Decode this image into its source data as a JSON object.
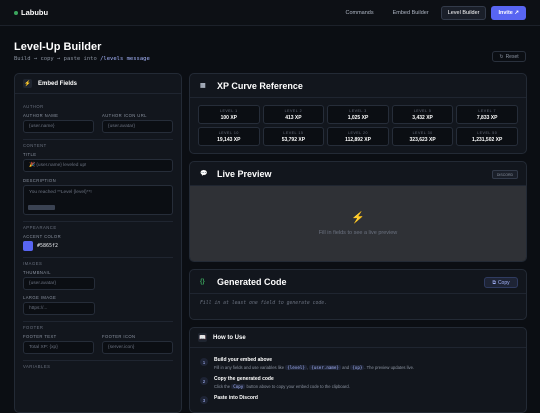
{
  "nav": {
    "logo": "Labubu",
    "links": [
      "Commands",
      "Embed Builder",
      "Level Builder",
      "Invite ↗"
    ]
  },
  "header": {
    "title": "Level-Up Builder",
    "subtitle_prefix": "Build → copy → paste into ",
    "subtitle_cmd": "/levels message",
    "reset": "Reset"
  },
  "embed": {
    "title": "Embed Fields",
    "sections": {
      "author": "AUTHOR",
      "content": "CONTENT",
      "appearance": "APPEARANCE",
      "images": "IMAGES",
      "footer": "FOOTER",
      "variables": "VARIABLES"
    },
    "author_name_label": "AUTHOR NAME",
    "author_name_placeholder": "{user.name}",
    "author_icon_label": "AUTHOR ICON URL",
    "author_icon_placeholder": "{user.avatar}",
    "title_label": "TITLE",
    "title_placeholder": "🎉 {user.name} leveled up!",
    "desc_label": "DESCRIPTION",
    "desc_placeholder": "You reached **Level {level}**!",
    "accent_label": "ACCENT COLOR",
    "accent_value": "#5865f2",
    "thumb_label": "THUMBNAIL",
    "thumb_placeholder": "{user.avatar}",
    "large_label": "LARGE IMAGE",
    "large_placeholder": "https://...",
    "footer_text_label": "FOOTER TEXT",
    "footer_text_placeholder": "Total XP: {xp}",
    "footer_icon_label": "FOOTER ICON",
    "footer_icon_placeholder": "{server.icon}"
  },
  "xp": {
    "title": "XP Curve Reference",
    "levels": [
      {
        "label": "LEVEL 1",
        "value": "100 XP"
      },
      {
        "label": "LEVEL 2",
        "value": "413 XP"
      },
      {
        "label": "LEVEL 3",
        "value": "1,025 XP"
      },
      {
        "label": "LEVEL 5",
        "value": "3,432 XP"
      },
      {
        "label": "LEVEL 7",
        "value": "7,833 XP"
      },
      {
        "label": "LEVEL 10",
        "value": "19,143 XP"
      },
      {
        "label": "LEVEL 15",
        "value": "53,792 XP"
      },
      {
        "label": "LEVEL 20",
        "value": "112,892 XP"
      },
      {
        "label": "LEVEL 30",
        "value": "323,623 XP"
      },
      {
        "label": "LEVEL 50",
        "value": "1,231,502 XP"
      }
    ]
  },
  "preview": {
    "title": "Live Preview",
    "badge": "DISCORD",
    "empty": "Fill in fields to see a live preview"
  },
  "code": {
    "title": "Generated Code",
    "copy": "Copy",
    "empty": "Fill in at least one field to generate code."
  },
  "how": {
    "title": "How to Use",
    "steps": [
      {
        "title": "Build your embed above",
        "desc_a": "Fill in any fields and use variables like ",
        "v1": "{level}",
        "v2": "{user.name}",
        "desc_b": " and ",
        "v3": "{xp}",
        "desc_c": ". The preview updates live."
      },
      {
        "title": "Copy the generated code",
        "desc_a": "Click the ",
        "btn": "Copy",
        "desc_b": " button above to copy your embed code to the clipboard."
      },
      {
        "title": "Paste into Discord"
      }
    ]
  },
  "colors": {
    "accent": "#5865f2"
  }
}
